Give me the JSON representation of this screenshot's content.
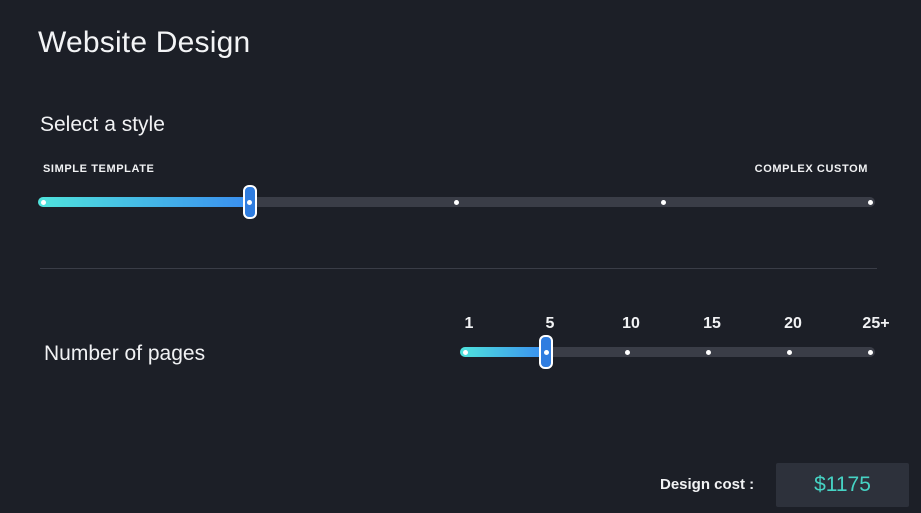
{
  "page": {
    "title": "Website Design"
  },
  "style_section": {
    "title": "Select a style",
    "min_label": "SIMPLE TEMPLATE",
    "max_label": "COMPLEX CUSTOM",
    "stops": 5,
    "selected_index": 1
  },
  "pages_section": {
    "title": "Number of pages",
    "ticks": [
      "1",
      "5",
      "10",
      "15",
      "20",
      "25+"
    ],
    "selected_index": 1
  },
  "cost": {
    "label": "Design cost :",
    "value": "$1175"
  },
  "colors": {
    "background": "#1c1f27",
    "track": "#3a3d47",
    "fill_start": "#4fe3dc",
    "fill_end": "#3a8ef0",
    "thumb": "#2f7de0",
    "cost_text": "#46d3c4"
  }
}
